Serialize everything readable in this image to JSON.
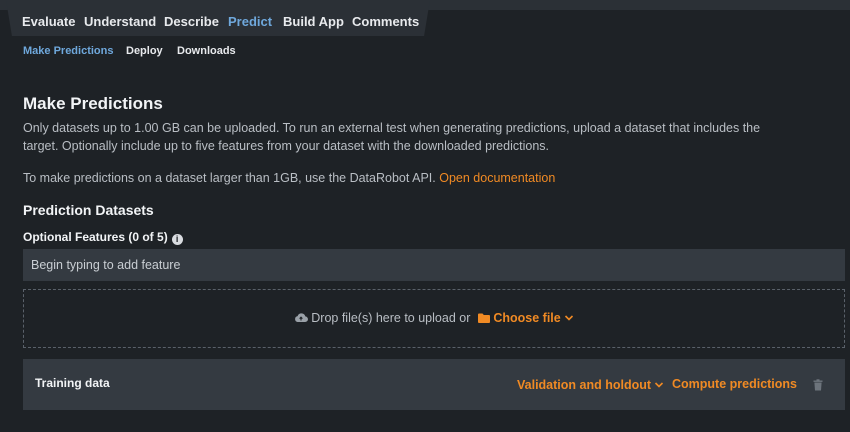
{
  "tabs": [
    {
      "label": "Evaluate"
    },
    {
      "label": "Understand"
    },
    {
      "label": "Describe"
    },
    {
      "label": "Predict"
    },
    {
      "label": "Build App"
    },
    {
      "label": "Comments"
    }
  ],
  "subnav": [
    {
      "label": "Make Predictions"
    },
    {
      "label": "Deploy"
    },
    {
      "label": "Downloads"
    }
  ],
  "main": {
    "title": "Make Predictions",
    "intro": "Only datasets up to 1.00 GB can be uploaded. To run an external test when generating predictions, upload a dataset that includes the target. Optionally include up to five features from your dataset with the downloaded predictions.",
    "api_text": "To make predictions on a dataset larger than 1GB, use the DataRobot API.",
    "api_link": "Open documentation",
    "datasets_title": "Prediction Datasets",
    "optional_label": "Optional Features (0 of 5)",
    "feature_placeholder": "Begin typing to add feature",
    "drop_text": "Drop file(s) here to upload or",
    "choose_file": "Choose file"
  },
  "dataset_row": {
    "name": "Training data",
    "partition": "Validation and holdout",
    "compute": "Compute predictions"
  },
  "icons": {
    "info": "info-icon",
    "cloud": "cloud-upload-icon",
    "folder": "folder-icon",
    "chevron": "chevron-down-icon",
    "trash": "trash-icon"
  },
  "colors": {
    "background": "#1e2226",
    "panel": "#343a41",
    "active_tab": "#6fa8dc",
    "accent": "#f08a24"
  }
}
